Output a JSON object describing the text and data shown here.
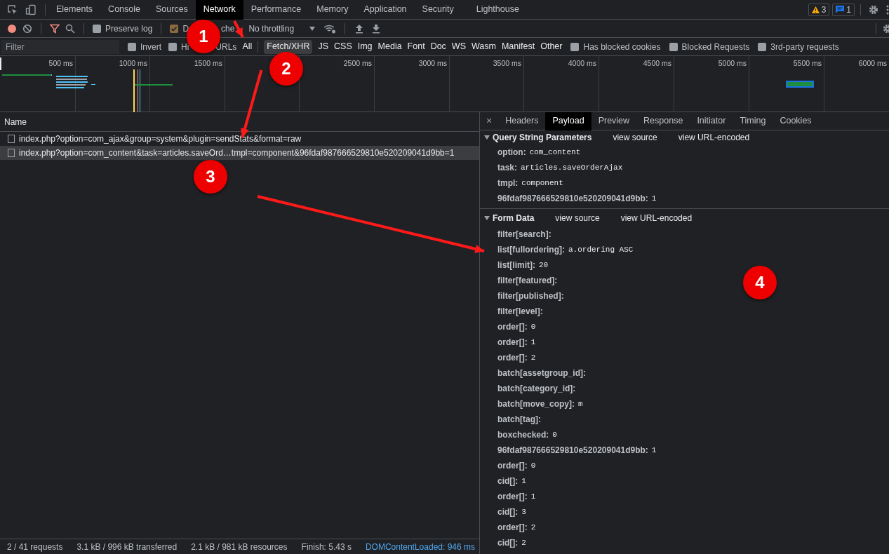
{
  "main_tabs": [
    {
      "label": "Elements",
      "selected": false
    },
    {
      "label": "Console",
      "selected": false
    },
    {
      "label": "Sources",
      "selected": false
    },
    {
      "label": "Network",
      "selected": true
    },
    {
      "label": "Performance",
      "selected": false
    },
    {
      "label": "Memory",
      "selected": false
    },
    {
      "label": "Application",
      "selected": false
    },
    {
      "label": "Security",
      "selected": false
    },
    {
      "label": "Lighthouse",
      "selected": false
    }
  ],
  "warnings_count": "3",
  "messages_count": "1",
  "toolbar": {
    "preserve_log": {
      "label": "Preserve log",
      "checked": false
    },
    "disable_cache": {
      "label_parts": [
        "D",
        "che"
      ],
      "checked": true
    },
    "throttling": "No throttling"
  },
  "filter_bar": {
    "placeholder": "Filter",
    "invert": {
      "label": "Invert",
      "checked": false
    },
    "hide_data_urls": {
      "label_parts": [
        "Hi",
        "URLs"
      ],
      "checked": false
    },
    "types": [
      {
        "label": "All",
        "selected": false
      },
      {
        "label": "Fetch/XHR",
        "selected": true
      },
      {
        "label": "JS",
        "selected": false
      },
      {
        "label": "CSS",
        "selected": false
      },
      {
        "label": "Img",
        "selected": false
      },
      {
        "label": "Media",
        "selected": false
      },
      {
        "label": "Font",
        "selected": false
      },
      {
        "label": "Doc",
        "selected": false
      },
      {
        "label": "WS",
        "selected": false
      },
      {
        "label": "Wasm",
        "selected": false
      },
      {
        "label": "Manifest",
        "selected": false
      },
      {
        "label": "Other",
        "selected": false
      }
    ],
    "options": [
      {
        "label": "Has blocked cookies",
        "checked": false
      },
      {
        "label": "Blocked Requests",
        "checked": false
      },
      {
        "label": "3rd-party requests",
        "checked": false
      }
    ]
  },
  "timeline": {
    "ticks": [
      "500 ms",
      "1000 ms",
      "1500 ms",
      "2500 ms",
      "3000 ms",
      "3500 ms",
      "4000 ms",
      "4500 ms",
      "5000 ms",
      "5500 ms",
      "6000 ms"
    ]
  },
  "requests": {
    "column": "Name",
    "rows": [
      {
        "name": "index.php?option=com_ajax&group=system&plugin=sendStats&format=raw",
        "selected": false
      },
      {
        "name": "index.php?option=com_content&task=articles.saveOrd…tmpl=component&96fdaf987666529810e520209041d9bb=1",
        "selected": true
      }
    ]
  },
  "detail_close": "×",
  "detail_tabs": [
    {
      "label": "Headers",
      "selected": false
    },
    {
      "label": "Payload",
      "selected": true
    },
    {
      "label": "Preview",
      "selected": false
    },
    {
      "label": "Response",
      "selected": false
    },
    {
      "label": "Initiator",
      "selected": false
    },
    {
      "label": "Timing",
      "selected": false
    },
    {
      "label": "Cookies",
      "selected": false
    }
  ],
  "sections": [
    {
      "title": "Query String Parameters",
      "links": [
        "view source",
        "view URL-encoded"
      ],
      "params": [
        {
          "key": "option:",
          "value": "com_content"
        },
        {
          "key": "task:",
          "value": "articles.saveOrderAjax"
        },
        {
          "key": "tmpl:",
          "value": "component"
        },
        {
          "key": "96fdaf987666529810e520209041d9bb:",
          "value": "1"
        }
      ]
    },
    {
      "title": "Form Data",
      "links": [
        "view source",
        "view URL-encoded"
      ],
      "params": [
        {
          "key": "filter[search]:"
        },
        {
          "key": "list[fullordering]:",
          "value": "a.ordering ASC"
        },
        {
          "key": "list[limit]:",
          "value": "20"
        },
        {
          "key": "filter[featured]:"
        },
        {
          "key": "filter[published]:"
        },
        {
          "key": "filter[level]:"
        },
        {
          "key": "order[]:",
          "value": "0"
        },
        {
          "key": "order[]:",
          "value": "1"
        },
        {
          "key": "order[]:",
          "value": "2"
        },
        {
          "key": "batch[assetgroup_id]:"
        },
        {
          "key": "batch[category_id]:"
        },
        {
          "key": "batch[move_copy]:",
          "value": "m"
        },
        {
          "key": "batch[tag]:"
        },
        {
          "key": "boxchecked:",
          "value": "0"
        },
        {
          "key": "96fdaf987666529810e520209041d9bb:",
          "value": "1"
        },
        {
          "key": "order[]:",
          "value": "0"
        },
        {
          "key": "cid[]:",
          "value": "1"
        },
        {
          "key": "order[]:",
          "value": "1"
        },
        {
          "key": "cid[]:",
          "value": "3"
        },
        {
          "key": "order[]:",
          "value": "2"
        },
        {
          "key": "cid[]:",
          "value": "2"
        }
      ]
    }
  ],
  "status_bar": [
    "2 / 41 requests",
    "3.1 kB / 996 kB transferred",
    "2.1 kB / 981 kB resources",
    "Finish: 5.43 s",
    "DOMContentLoaded: 946 ms"
  ],
  "annotations": [
    {
      "label": "1"
    },
    {
      "label": "2"
    },
    {
      "label": "3"
    },
    {
      "label": "4"
    }
  ]
}
